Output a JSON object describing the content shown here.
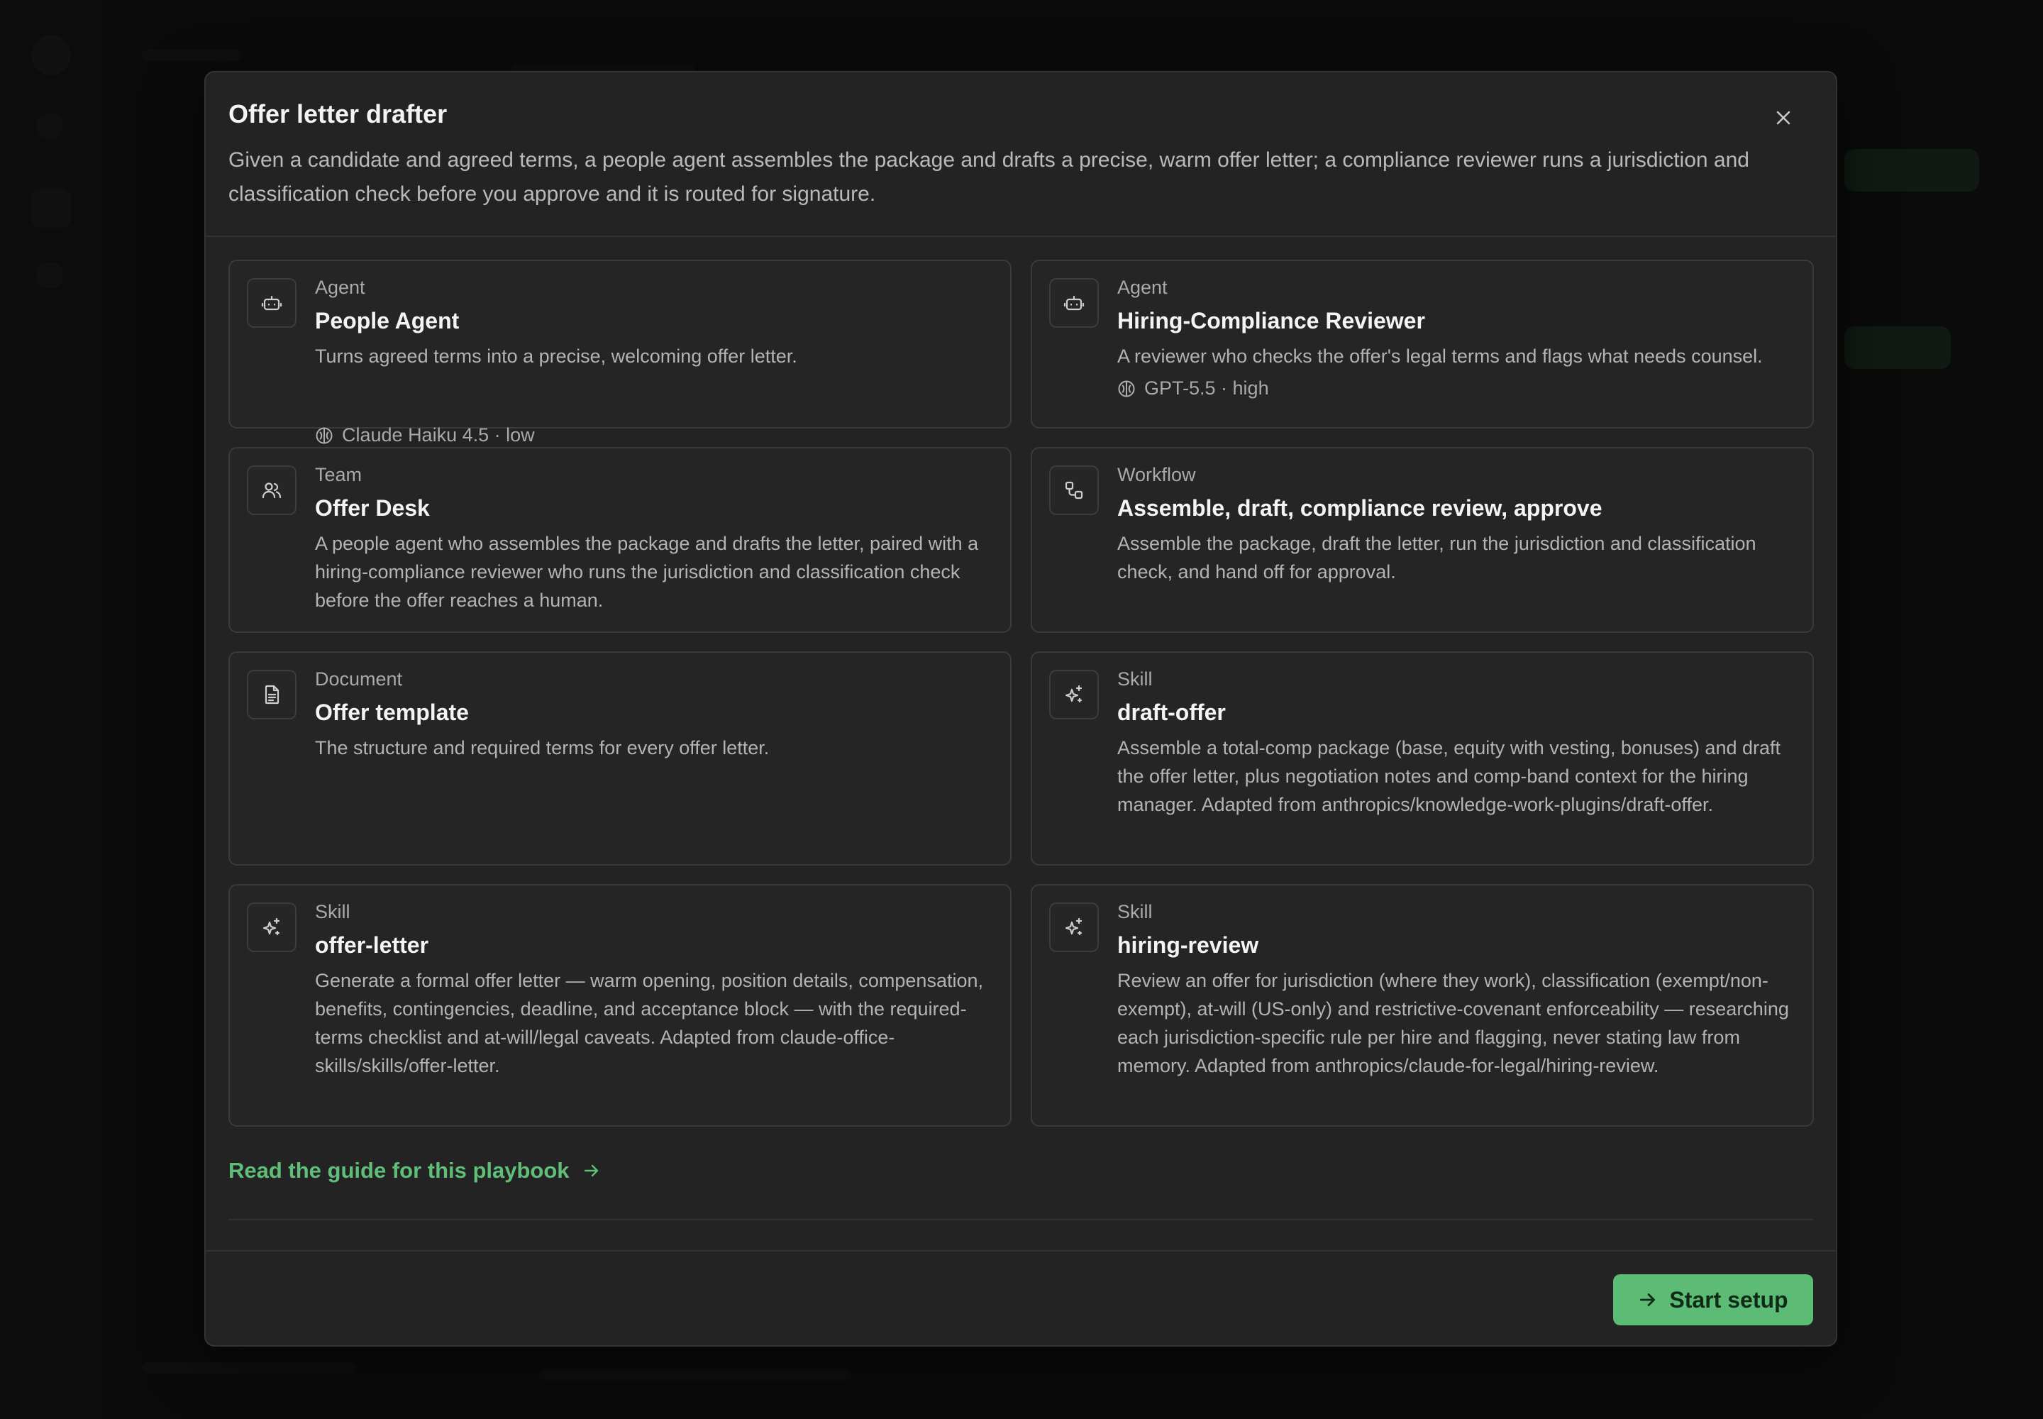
{
  "modal": {
    "title": "Offer letter drafter",
    "description": "Given a candidate and agreed terms, a people agent assembles the package and drafts a precise, warm offer letter; a compliance reviewer runs a jurisdiction and classification check before you approve and it is routed for signature.",
    "close_icon": "close-icon"
  },
  "cards": [
    {
      "kind": "Agent",
      "name": "People Agent",
      "text": "Turns agreed terms into a precise, welcoming offer letter.",
      "model": "Claude Haiku 4.5 · low",
      "icon": "robot-icon"
    },
    {
      "kind": "Agent",
      "name": "Hiring-Compliance Reviewer",
      "text": "A reviewer who checks the offer's legal terms and flags what needs counsel.",
      "model": "GPT-5.5 · high",
      "icon": "robot-icon"
    },
    {
      "kind": "Team",
      "name": "Offer Desk",
      "text": "A people agent who assembles the package and drafts the letter, paired with a hiring-compliance reviewer who runs the jurisdiction and classification check before the offer reaches a human.",
      "icon": "users-icon"
    },
    {
      "kind": "Workflow",
      "name": "Assemble, draft, compliance review, approve",
      "text": "Assemble the package, draft the letter, run the jurisdiction and classification check, and hand off for approval.",
      "icon": "workflow-icon"
    },
    {
      "kind": "Document",
      "name": "Offer template",
      "text": "The structure and required terms for every offer letter.",
      "icon": "document-icon"
    },
    {
      "kind": "Skill",
      "name": "draft-offer",
      "text": "Assemble a total-comp package (base, equity with vesting, bonuses) and draft the offer letter, plus negotiation notes and comp-band context for the hiring manager. Adapted from anthropics/knowledge-work-plugins/draft-offer.",
      "icon": "sparkle-icon"
    },
    {
      "kind": "Skill",
      "name": "offer-letter",
      "text": "Generate a formal offer letter — warm opening, position details, compensation, benefits, contingencies, deadline, and acceptance block — with the required-terms checklist and at-will/legal caveats. Adapted from claude-office-skills/skills/offer-letter.",
      "icon": "sparkle-icon"
    },
    {
      "kind": "Skill",
      "name": "hiring-review",
      "text": "Review an offer for jurisdiction (where they work), classification (exempt/non-exempt), at-will (US-only) and restrictive-covenant enforceability — researching each jurisdiction-specific rule per hire and flagging, never stating law from memory. Adapted from anthropics/claude-for-legal/hiring-review.",
      "icon": "sparkle-icon"
    }
  ],
  "footer": {
    "guide_link": "Read the guide for this playbook",
    "start_button": "Start setup"
  },
  "colors": {
    "accent": "#5cbb74",
    "link": "#5fbf79",
    "modal_bg": "#232323",
    "card_border": "#3a3a3a"
  }
}
